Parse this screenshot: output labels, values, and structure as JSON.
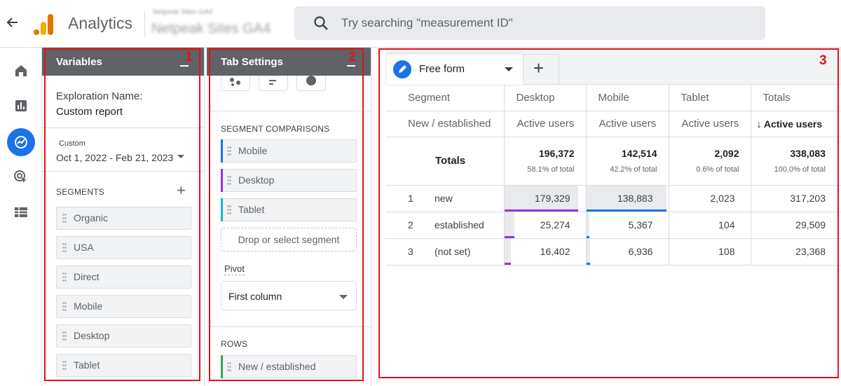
{
  "header": {
    "app_title": "Analytics",
    "property_account": "Netpeak Sites GA4",
    "property_name": "Netpeak Sites GA4",
    "search_placeholder": "Try searching \"measurement ID\""
  },
  "rail": [
    "home-icon",
    "reports-icon",
    "explore-icon",
    "advertising-icon",
    "configure-icon"
  ],
  "variables": {
    "title": "Variables",
    "number": "1",
    "exploration_label": "Exploration Name:",
    "exploration_value": "Custom report",
    "date_tag": "Custom",
    "date_range": "Oct 1, 2022 - Feb 21, 2023",
    "segments_label": "SEGMENTS",
    "segments": [
      "Organic",
      "USA",
      "Direct",
      "Mobile",
      "Desktop",
      "Tablet"
    ]
  },
  "tab_settings": {
    "title": "Tab Settings",
    "number": "2",
    "segment_comparisons_label": "SEGMENT COMPARISONS",
    "comparisons": [
      {
        "label": "Mobile",
        "color": "#1a73e8"
      },
      {
        "label": "Desktop",
        "color": "#9334e6"
      },
      {
        "label": "Tablet",
        "color": "#12b5cb"
      }
    ],
    "drop_label": "Drop or select segment",
    "pivot_label": "Pivot",
    "pivot_value": "First column",
    "rows_label": "ROWS",
    "rows": [
      {
        "label": "New / established",
        "color": "#34a853"
      }
    ]
  },
  "canvas": {
    "number": "3",
    "tab_label": "Free form",
    "add_tab": "+",
    "columns": [
      "Segment",
      "Desktop",
      "Mobile",
      "Tablet",
      "Totals"
    ],
    "subheader": [
      "New / established",
      "Active users",
      "Active users",
      "Active users",
      "↓ Active users"
    ],
    "totals_label": "Totals",
    "totals": [
      {
        "value": "196,372",
        "pct": "58.1% of total"
      },
      {
        "value": "142,514",
        "pct": "42.2% of total"
      },
      {
        "value": "2,092",
        "pct": "0.6% of total"
      },
      {
        "value": "338,083",
        "pct": "100.0% of total"
      }
    ],
    "rows": [
      {
        "idx": "1",
        "name": "new",
        "values": [
          "179,329",
          "138,883",
          "2,023",
          "317,203"
        ]
      },
      {
        "idx": "2",
        "name": "established",
        "values": [
          "25,274",
          "5,367",
          "104",
          "29,509"
        ]
      },
      {
        "idx": "3",
        "name": "(not set)",
        "values": [
          "16,402",
          "6,936",
          "108",
          "23,368"
        ]
      }
    ],
    "colors": {
      "desktop": "#9334e6",
      "mobile": "#1a73e8"
    }
  }
}
